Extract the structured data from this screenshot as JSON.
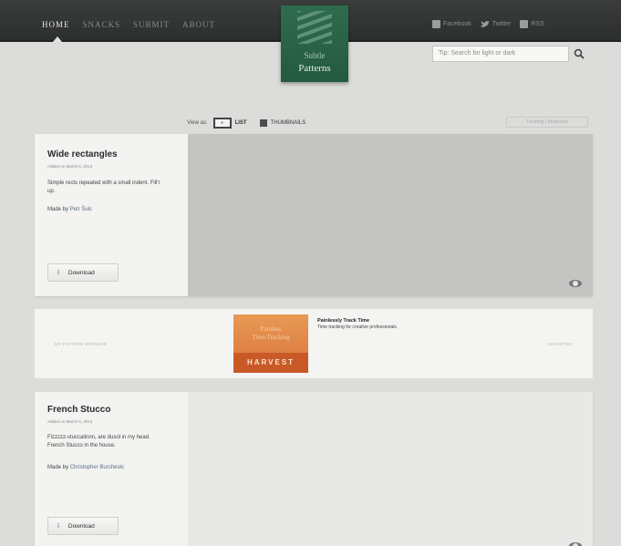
{
  "nav": {
    "items": [
      "HOME",
      "SNACKS",
      "SUBMIT",
      "ABOUT"
    ]
  },
  "social": {
    "facebook": "Facebook",
    "twitter": "Twitter",
    "rss": "RSS"
  },
  "logo": {
    "line1": "Subtle",
    "line2": "Patterns"
  },
  "search": {
    "placeholder": "Tip: Search for light or dark"
  },
  "view": {
    "label": "View as:",
    "list_icon_text": "≡",
    "list": "LIST",
    "thumbnails": "THUMBNAILS",
    "trending": "Trending / Bookmark"
  },
  "patterns": [
    {
      "title": "Wide rectangles",
      "date": "Added on March 6, 2013",
      "description": "Simple rects repeated with a small indent. Fill'r up.",
      "by_label": "Made by",
      "author": "Petr Šulc",
      "download": "Download",
      "preview_color": "#c4c4c2"
    },
    {
      "title": "French Stucco",
      "date": "Added on March 6, 2013",
      "description": "Fizzzzz-stuccalinnn, are dusol in my head. French Stucco in the house.",
      "by_label": "Made by",
      "author": "Christopher Burcheski",
      "download": "Download",
      "preview_color": "#e8e8e6"
    }
  ],
  "sponsor": {
    "left": "MY PATTERN SPONSOR",
    "right": "ADVERTISE",
    "ad_line1": "Painless",
    "ad_line2": "Time Tracking",
    "ad_brand": "HARVEST",
    "headline": "Painlessly Track Time",
    "body": "Time tracking for creative professionals."
  },
  "colors": {
    "topbar": "#2e3130",
    "logo": "#2b6348",
    "sponsor_orange": "#d9733a"
  }
}
